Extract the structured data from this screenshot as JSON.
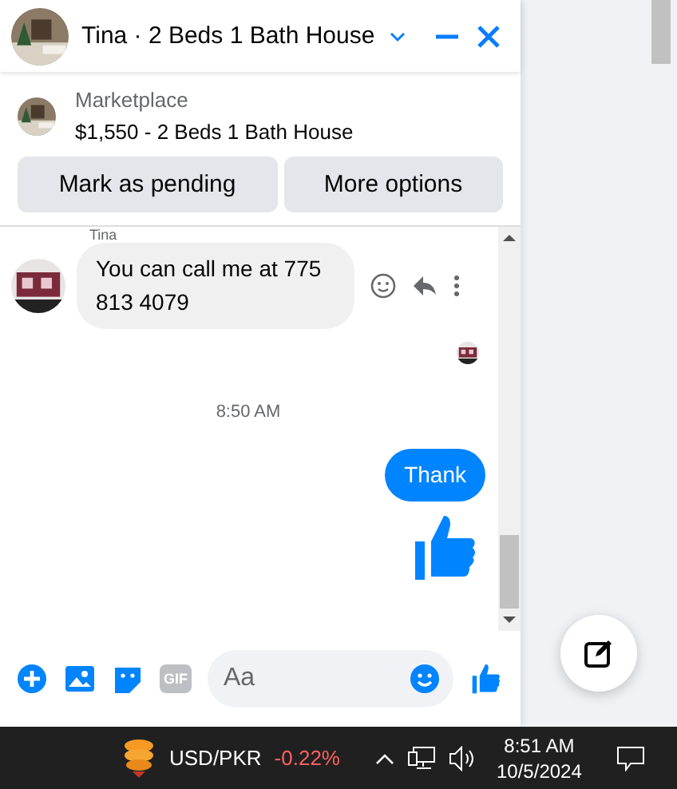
{
  "header": {
    "title": "Tina · 2 Beds 1 Bath House"
  },
  "listing": {
    "source": "Marketplace",
    "title": "$1,550 - 2 Beds 1 Bath House"
  },
  "actions": [
    "Mark as pending",
    "More options"
  ],
  "messages": [
    {
      "kind": "sender",
      "text": "Tina"
    },
    {
      "kind": "incoming",
      "text": "You can call me at 775 813 4079"
    },
    {
      "kind": "seen"
    },
    {
      "kind": "time",
      "text": "8:50 AM"
    },
    {
      "kind": "outgoing",
      "text": "Thank"
    },
    {
      "kind": "like"
    }
  ],
  "composer": {
    "placeholder": "Aa",
    "gif": "GIF"
  },
  "taskbar": {
    "ticker": "USD/PKR",
    "change": "-0.22%",
    "time": "8:51 AM",
    "date": "10/5/2024"
  }
}
